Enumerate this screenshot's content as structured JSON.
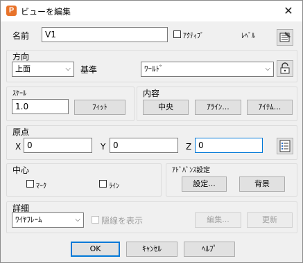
{
  "window": {
    "title": "ビューを編集",
    "close_label": "✕"
  },
  "name_row": {
    "label": "名前",
    "value": "V1",
    "active_label": "ｱｸﾃｨﾌﾞ",
    "level_label": "ﾚﾍﾞﾙ"
  },
  "direction": {
    "group_label": "方向",
    "view_value": "上面",
    "reference_label": "基準",
    "reference_value": "ﾜｰﾙﾄﾞ"
  },
  "scale": {
    "group_label": "ｽｹｰﾙ",
    "value": "1.0",
    "fit_label": "ﾌｨｯﾄ"
  },
  "content": {
    "group_label": "内容",
    "center_label": "中央",
    "align_label": "ｱﾗｲﾝ...",
    "item_label": "ｱｲﾃﾑ..."
  },
  "origin": {
    "group_label": "原点",
    "x_label": "X",
    "x_value": "0",
    "y_label": "Y",
    "y_value": "0",
    "z_label": "Z",
    "z_value": "0"
  },
  "center": {
    "group_label": "中心",
    "mark_label": "ﾏｰｸ",
    "line_label": "ﾗｲﾝ"
  },
  "advanced": {
    "group_label": "ｱﾄﾞﾊﾞﾝｽ設定",
    "settings_label": "設定...",
    "background_label": "背景"
  },
  "detail": {
    "group_label": "詳細",
    "mode_value": "ﾜｲﾔﾌﾚｰﾑ",
    "hidden_label": "隠線を表示",
    "edit_label": "編集...",
    "update_label": "更新"
  },
  "footer": {
    "ok_label": "OK",
    "cancel_label": "ｷｬﾝｾﾙ",
    "help_label": "ﾍﾙﾌﾟ"
  },
  "icons": {
    "app": "app-logo-icon",
    "level": "level-icon",
    "lock": "lock-icon",
    "list": "list-icon",
    "close": "close-icon",
    "dropdown": "chevron-down-icon"
  },
  "colors": {
    "accent": "#0078d7",
    "app_icon": "#e8732a",
    "background": "#f0f0f0"
  }
}
